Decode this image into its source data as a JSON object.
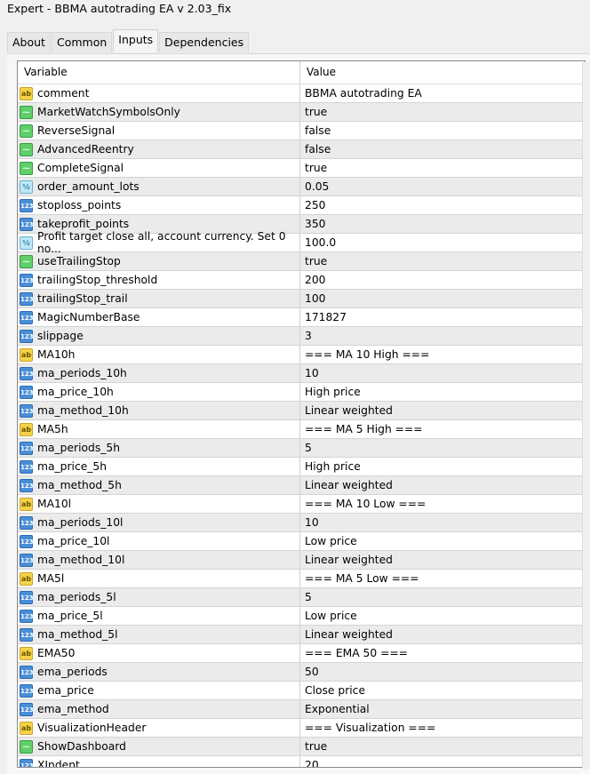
{
  "window": {
    "title": "Expert - BBMA autotrading EA v 2.03_fix"
  },
  "tabs": [
    {
      "label": "About"
    },
    {
      "label": "Common"
    },
    {
      "label": "Inputs"
    },
    {
      "label": "Dependencies"
    }
  ],
  "active_tab": "Inputs",
  "table": {
    "headers": {
      "variable": "Variable",
      "value": "Value"
    },
    "rows": [
      {
        "type": "string",
        "name": "comment",
        "value": "BBMA autotrading EA"
      },
      {
        "type": "bool",
        "name": "MarketWatchSymbolsOnly",
        "value": "true"
      },
      {
        "type": "bool",
        "name": "ReverseSignal",
        "value": "false"
      },
      {
        "type": "bool",
        "name": "AdvancedReentry",
        "value": "false"
      },
      {
        "type": "bool",
        "name": "CompleteSignal",
        "value": "true"
      },
      {
        "type": "double",
        "name": "order_amount_lots",
        "value": "0.05"
      },
      {
        "type": "int",
        "name": "stoploss_points",
        "value": "250"
      },
      {
        "type": "int",
        "name": "takeprofit_points",
        "value": "350"
      },
      {
        "type": "double",
        "name": "Profit target close all, account currency. Set 0 no...",
        "value": "100.0"
      },
      {
        "type": "bool",
        "name": "useTrailingStop",
        "value": "true"
      },
      {
        "type": "int",
        "name": "trailingStop_threshold",
        "value": "200"
      },
      {
        "type": "int",
        "name": "trailingStop_trail",
        "value": "100"
      },
      {
        "type": "int",
        "name": "MagicNumberBase",
        "value": "171827"
      },
      {
        "type": "int",
        "name": "slippage",
        "value": "3"
      },
      {
        "type": "string",
        "name": "MA10h",
        "value": "=== MA 10 High ==="
      },
      {
        "type": "int",
        "name": "ma_periods_10h",
        "value": "10"
      },
      {
        "type": "int",
        "name": "ma_price_10h",
        "value": "High price"
      },
      {
        "type": "int",
        "name": "ma_method_10h",
        "value": "Linear weighted"
      },
      {
        "type": "string",
        "name": "MA5h",
        "value": "=== MA 5 High ==="
      },
      {
        "type": "int",
        "name": "ma_periods_5h",
        "value": "5"
      },
      {
        "type": "int",
        "name": "ma_price_5h",
        "value": "High price"
      },
      {
        "type": "int",
        "name": "ma_method_5h",
        "value": "Linear weighted"
      },
      {
        "type": "string",
        "name": "MA10l",
        "value": "=== MA 10 Low ==="
      },
      {
        "type": "int",
        "name": "ma_periods_10l",
        "value": "10"
      },
      {
        "type": "int",
        "name": "ma_price_10l",
        "value": "Low price"
      },
      {
        "type": "int",
        "name": "ma_method_10l",
        "value": "Linear weighted"
      },
      {
        "type": "string",
        "name": "MA5l",
        "value": "=== MA 5 Low ==="
      },
      {
        "type": "int",
        "name": "ma_periods_5l",
        "value": "5"
      },
      {
        "type": "int",
        "name": "ma_price_5l",
        "value": "Low price"
      },
      {
        "type": "int",
        "name": "ma_method_5l",
        "value": "Linear weighted"
      },
      {
        "type": "string",
        "name": "EMA50",
        "value": "=== EMA 50 ==="
      },
      {
        "type": "int",
        "name": "ema_periods",
        "value": "50"
      },
      {
        "type": "int",
        "name": "ema_price",
        "value": "Close price"
      },
      {
        "type": "int",
        "name": "ema_method",
        "value": "Exponential"
      },
      {
        "type": "string",
        "name": "VisualizationHeader",
        "value": "=== Visualization ==="
      },
      {
        "type": "bool",
        "name": "ShowDashboard",
        "value": "true"
      },
      {
        "type": "int",
        "name": "XIndent",
        "value": "20"
      }
    ]
  },
  "icon_glyphs": {
    "string": "ab",
    "bool": "⁓",
    "double": "½",
    "int": "123"
  }
}
